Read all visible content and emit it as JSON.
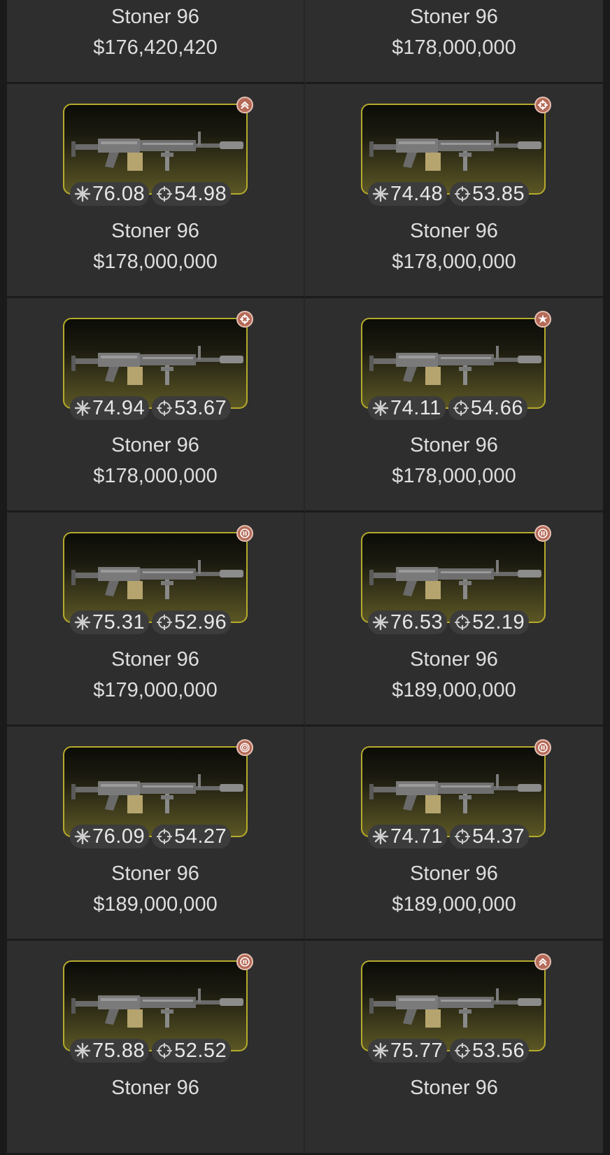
{
  "listings": [
    {
      "name": "Stoner 96",
      "price": "$176,420,420",
      "damage": "",
      "accuracy": "",
      "badge": "none"
    },
    {
      "name": "Stoner 96",
      "price": "$178,000,000",
      "damage": "",
      "accuracy": "",
      "badge": "none"
    },
    {
      "name": "Stoner 96",
      "price": "$178,000,000",
      "damage": "76.08",
      "accuracy": "54.98",
      "badge": "chevron-up-icon"
    },
    {
      "name": "Stoner 96",
      "price": "$178,000,000",
      "damage": "74.48",
      "accuracy": "53.85",
      "badge": "crosshair-icon"
    },
    {
      "name": "Stoner 96",
      "price": "$178,000,000",
      "damage": "74.94",
      "accuracy": "53.67",
      "badge": "crosshair-icon"
    },
    {
      "name": "Stoner 96",
      "price": "$178,000,000",
      "damage": "74.11",
      "accuracy": "54.66",
      "badge": "burst-icon"
    },
    {
      "name": "Stoner 96",
      "price": "$179,000,000",
      "damage": "75.31",
      "accuracy": "52.96",
      "badge": "pause-icon"
    },
    {
      "name": "Stoner 96",
      "price": "$189,000,000",
      "damage": "76.53",
      "accuracy": "52.19",
      "badge": "pause-icon"
    },
    {
      "name": "Stoner 96",
      "price": "$189,000,000",
      "damage": "76.09",
      "accuracy": "54.27",
      "badge": "spiral-icon"
    },
    {
      "name": "Stoner 96",
      "price": "$189,000,000",
      "damage": "74.71",
      "accuracy": "54.37",
      "badge": "pause-icon"
    },
    {
      "name": "Stoner 96",
      "price": "",
      "damage": "75.88",
      "accuracy": "52.52",
      "badge": "pause-icon"
    },
    {
      "name": "Stoner 96",
      "price": "",
      "damage": "75.77",
      "accuracy": "53.56",
      "badge": "chevron-up-icon"
    }
  ],
  "colors": {
    "background": "#2e2e2e",
    "card_border": "#b5ab2c",
    "badge": "#b56a58",
    "text": "#dedede"
  }
}
